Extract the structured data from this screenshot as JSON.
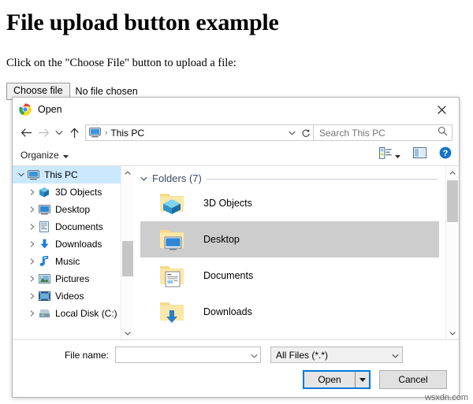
{
  "page": {
    "heading": "File upload button example",
    "paragraph": "Click on the \"Choose File\" button to upload a file:",
    "choose_file_label": "Choose file",
    "no_file_text": "No file chosen"
  },
  "dialog": {
    "title": "Open",
    "app_icon": "chrome-icon",
    "close_icon": "close-icon",
    "nav": {
      "back_icon": "back-arrow-icon",
      "forward_icon": "forward-arrow-icon",
      "recent_icon": "chevron-down-icon",
      "up_icon": "up-arrow-icon",
      "breadcrumb_icon": "this-pc-icon",
      "breadcrumb_separator": "›",
      "breadcrumb_text": "This PC",
      "breadcrumb_dropdown_icon": "chevron-down-icon",
      "refresh_icon": "refresh-icon",
      "search_placeholder": "Search This PC",
      "search_value": "",
      "search_icon": "search-icon"
    },
    "toolbar": {
      "organize_label": "Organize",
      "organize_caret_icon": "caret-down-icon",
      "view_icon": "view-layout-icon",
      "view_caret_icon": "caret-down-icon",
      "preview_pane_icon": "preview-pane-icon",
      "help_icon": "help-icon"
    },
    "navpane": {
      "items": [
        {
          "label": "This PC",
          "icon": "this-pc-icon",
          "selected": true,
          "level": 0,
          "expander": "chevron-down"
        },
        {
          "label": "3D Objects",
          "icon": "3d-objects-icon",
          "selected": false,
          "level": 1,
          "expander": "chevron-right"
        },
        {
          "label": "Desktop",
          "icon": "desktop-icon",
          "selected": false,
          "level": 1,
          "expander": "chevron-right"
        },
        {
          "label": "Documents",
          "icon": "documents-icon",
          "selected": false,
          "level": 1,
          "expander": "chevron-right"
        },
        {
          "label": "Downloads",
          "icon": "downloads-icon",
          "selected": false,
          "level": 1,
          "expander": "chevron-right"
        },
        {
          "label": "Music",
          "icon": "music-icon",
          "selected": false,
          "level": 1,
          "expander": "chevron-right"
        },
        {
          "label": "Pictures",
          "icon": "pictures-icon",
          "selected": false,
          "level": 1,
          "expander": "chevron-right"
        },
        {
          "label": "Videos",
          "icon": "videos-icon",
          "selected": false,
          "level": 1,
          "expander": "chevron-right"
        },
        {
          "label": "Local Disk (C:)",
          "icon": "local-disk-icon",
          "selected": false,
          "level": 1,
          "expander": "chevron-right"
        }
      ]
    },
    "content": {
      "group_header": "Folders (7)",
      "group_expander_icon": "chevron-down-icon",
      "items": [
        {
          "label": "3D Objects",
          "icon": "folder-3d-objects-icon",
          "selected": false
        },
        {
          "label": "Desktop",
          "icon": "folder-desktop-icon",
          "selected": true
        },
        {
          "label": "Documents",
          "icon": "folder-documents-icon",
          "selected": false
        },
        {
          "label": "Downloads",
          "icon": "folder-downloads-icon",
          "selected": false
        }
      ]
    },
    "footer": {
      "file_name_label": "File name:",
      "file_name_value": "",
      "file_name_dropdown_icon": "chevron-down-icon",
      "filter_value": "All Files (*.*)",
      "filter_dropdown_icon": "chevron-down-icon",
      "open_label": "Open",
      "open_dropdown_icon": "caret-down-icon",
      "cancel_label": "Cancel"
    }
  },
  "watermark": "wsxdn.com",
  "colors": {
    "accent": "#0078d7",
    "tree_selection": "#cce8ff",
    "list_selection": "#cdcdcd",
    "group_header_text": "#3b4a68"
  }
}
